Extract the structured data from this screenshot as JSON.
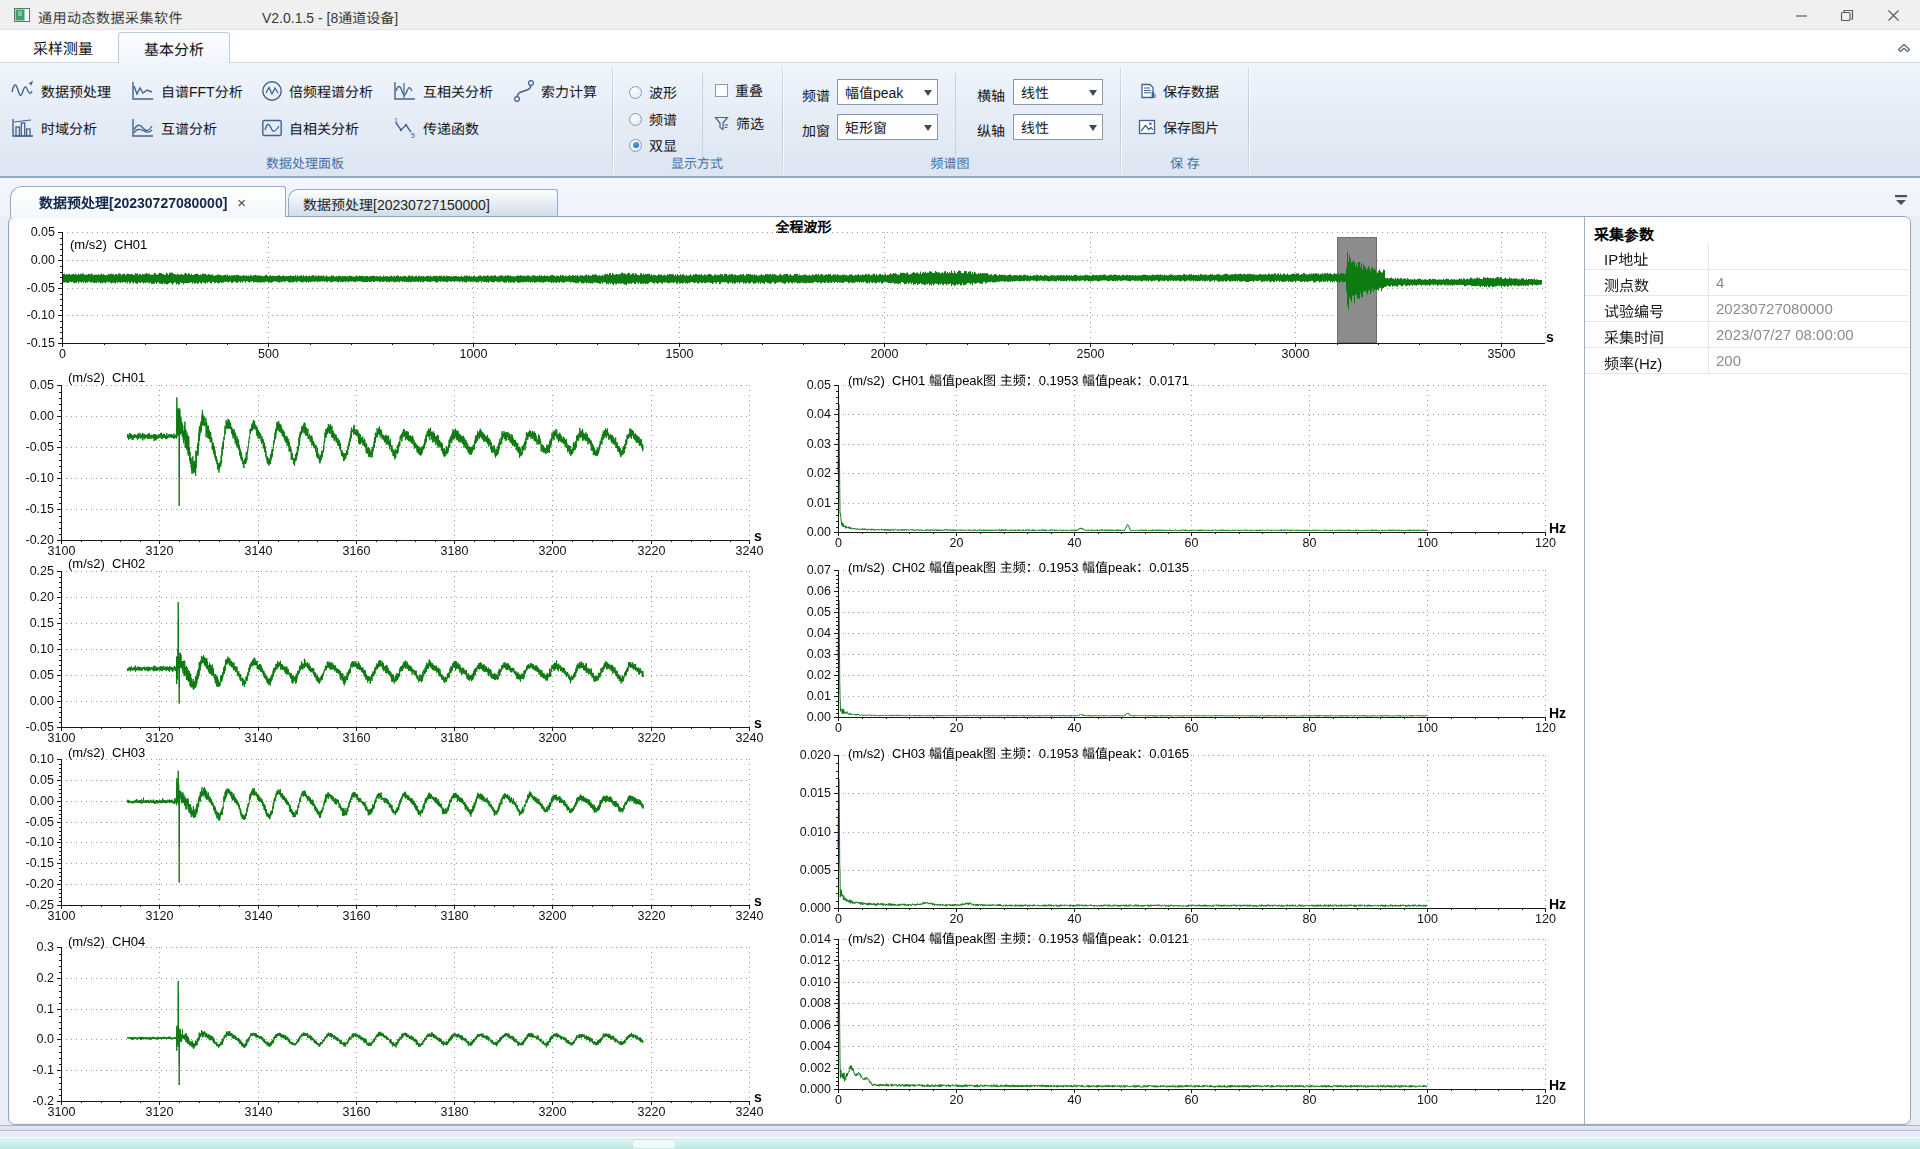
{
  "window": {
    "title": "通用动态数据采集软件",
    "version": "V2.0.1.5 - [8通道设备]"
  },
  "ribbon_tabs": {
    "sampling": "采样测量",
    "analysis": "基本分析"
  },
  "ribbon": {
    "group1": {
      "label": "数据处理面板",
      "btn_preprocess": "数据预处理",
      "btn_fft": "自谱FFT分析",
      "btn_octave": "倍频程谱分析",
      "btn_xcorr": "互相关分析",
      "btn_cable": "索力计算",
      "btn_timedomain": "时域分析",
      "btn_xspec": "互谱分析",
      "btn_autocorr": "自相关分析",
      "btn_transfer": "传递函数"
    },
    "group2": {
      "label": "显示方式",
      "radio_wave": "波形",
      "radio_spec": "频谱",
      "radio_dual": "双显",
      "selected_radio": "双显",
      "chk_overlap": "重叠",
      "chk_overlap_checked": false,
      "btn_filter": "筛选"
    },
    "group3": {
      "label": "频谱图",
      "lbl_spectrum": "频谱",
      "val_spectrum": "幅值peak",
      "lbl_window": "加窗",
      "val_window": "矩形窗",
      "lbl_xaxis": "横轴",
      "val_xaxis": "线性",
      "lbl_yaxis": "纵轴",
      "val_yaxis": "线性"
    },
    "group4": {
      "label": "保 存",
      "btn_savedata": "保存数据",
      "btn_saveimage": "保存图片"
    }
  },
  "doc_tabs": {
    "tab1": "数据预处理[20230727080000]",
    "tab1_close": "×",
    "tab2": "数据预处理[20230727150000]"
  },
  "params_panel": {
    "title": "采集参数",
    "rows": [
      {
        "label": "IP地址",
        "value": ""
      },
      {
        "label": "测点数",
        "value": "4"
      },
      {
        "label": "试验编号",
        "value": "20230727080000"
      },
      {
        "label": "采集时间",
        "value": "2023/07/27 08:00:00"
      },
      {
        "label": "频率(Hz)",
        "value": "200"
      }
    ]
  },
  "chart_data": [
    {
      "id": "overview",
      "type": "line",
      "title": "全程波形",
      "series_label": "(m/s2)  CH01",
      "unit": "s",
      "line_color": "#0e7a12",
      "x_range": [
        0,
        3608
      ],
      "y_range": [
        0.05,
        -0.15
      ],
      "x_ticks": [
        {
          "v": 0,
          "l": "0"
        },
        {
          "v": 500,
          "l": "500"
        },
        {
          "v": 1000,
          "l": "1000"
        },
        {
          "v": 1500,
          "l": "1500"
        },
        {
          "v": 2000,
          "l": "2000"
        },
        {
          "v": 2500,
          "l": "2500"
        },
        {
          "v": 3000,
          "l": "3000"
        },
        {
          "v": 3500,
          "l": "3500"
        }
      ],
      "y_ticks": [
        {
          "v": 0.05,
          "l": "0.05"
        },
        {
          "v": 0.0,
          "l": "0.00"
        },
        {
          "v": -0.05,
          "l": "-0.05"
        },
        {
          "v": -0.1,
          "l": "-0.10"
        },
        {
          "v": -0.15,
          "l": "-0.15"
        }
      ],
      "selection": {
        "t0": 3102,
        "t1": 3200,
        "fill": "#8c8c8c",
        "border": "#6f6f6f"
      },
      "gen": {
        "kind": "overview",
        "seed": 11,
        "t_end": 3600,
        "base": -0.0335,
        "half": 0.0062,
        "event_t": 3123.5,
        "event_end": 3218.5,
        "osc_amp": 0.034,
        "osc_tau": 42,
        "post_base": -0.0405,
        "bumps": [
          [
            270,
            60,
            0.002
          ],
          [
            1360,
            40,
            0.0025
          ],
          [
            2120,
            70,
            0.0045
          ],
          [
            2200,
            40,
            0.003
          ],
          [
            3480,
            50,
            0.003
          ]
        ]
      }
    },
    {
      "id": "time_ch01",
      "type": "line",
      "title": "(m/s2)  CH01",
      "unit": "s",
      "line_color": "#0e7a12",
      "x_range": [
        3100,
        3240
      ],
      "y_range": [
        0.05,
        -0.2
      ],
      "x_ticks": [
        {
          "v": 3100,
          "l": "3100"
        },
        {
          "v": 3120,
          "l": "3120"
        },
        {
          "v": 3140,
          "l": "3140"
        },
        {
          "v": 3160,
          "l": "3160"
        },
        {
          "v": 3180,
          "l": "3180"
        },
        {
          "v": 3200,
          "l": "3200"
        },
        {
          "v": 3220,
          "l": "3220"
        },
        {
          "v": 3240,
          "l": "3240"
        }
      ],
      "y_ticks": [
        {
          "v": 0.05,
          "l": "0.05"
        },
        {
          "v": 0,
          "l": "0.00"
        },
        {
          "v": -0.05,
          "l": "-0.05"
        },
        {
          "v": -0.1,
          "l": "-0.10"
        },
        {
          "v": -0.15,
          "l": "-0.15"
        },
        {
          "v": -0.2,
          "l": "-0.20"
        }
      ],
      "gen": {
        "kind": "timezoom",
        "seed": 21,
        "base": -0.033,
        "sigma0": 0.0032,
        "spike_up": 0.012,
        "spike_dn": -0.145,
        "osc_mean": -0.042,
        "A0": 0.023,
        "A1": 0.0105,
        "tau": 50,
        "sigma1": 0.0058,
        "f0": 0.1953,
        "h2": 0.3
      }
    },
    {
      "id": "time_ch02",
      "type": "line",
      "title": "(m/s2)  CH02",
      "unit": "s",
      "line_color": "#0e7a12",
      "x_range": [
        3100,
        3240
      ],
      "y_range": [
        0.25,
        -0.05
      ],
      "x_ticks": [
        {
          "v": 3100,
          "l": "3100"
        },
        {
          "v": 3120,
          "l": "3120"
        },
        {
          "v": 3140,
          "l": "3140"
        },
        {
          "v": 3160,
          "l": "3160"
        },
        {
          "v": 3180,
          "l": "3180"
        },
        {
          "v": 3200,
          "l": "3200"
        },
        {
          "v": 3220,
          "l": "3220"
        },
        {
          "v": 3240,
          "l": "3240"
        }
      ],
      "y_ticks": [
        {
          "v": 0.25,
          "l": "0.25"
        },
        {
          "v": 0.2,
          "l": "0.20"
        },
        {
          "v": 0.15,
          "l": "0.15"
        },
        {
          "v": 0.1,
          "l": "0.10"
        },
        {
          "v": 0.05,
          "l": "0.05"
        },
        {
          "v": 0,
          "l": "0.00"
        },
        {
          "v": -0.05,
          "l": "-0.05"
        }
      ],
      "gen": {
        "kind": "timezoom",
        "seed": 22,
        "base": 0.062,
        "sigma0": 0.003,
        "spike_up": 0.19,
        "spike_dn": -0.005,
        "osc_mean": 0.057,
        "A0": 0.014,
        "A1": 0.009,
        "tau": 60,
        "sigma1": 0.0052,
        "f0": 0.1953,
        "h2": 0.25
      }
    },
    {
      "id": "time_ch03",
      "type": "line",
      "title": "(m/s2)  CH03",
      "unit": "s",
      "line_color": "#0e7a12",
      "x_range": [
        3100,
        3240
      ],
      "y_range": [
        0.1,
        -0.25
      ],
      "x_ticks": [
        {
          "v": 3100,
          "l": "3100"
        },
        {
          "v": 3120,
          "l": "3120"
        },
        {
          "v": 3140,
          "l": "3140"
        },
        {
          "v": 3160,
          "l": "3160"
        },
        {
          "v": 3180,
          "l": "3180"
        },
        {
          "v": 3200,
          "l": "3200"
        },
        {
          "v": 3220,
          "l": "3220"
        },
        {
          "v": 3240,
          "l": "3240"
        }
      ],
      "y_ticks": [
        {
          "v": 0.1,
          "l": "0.10"
        },
        {
          "v": 0.05,
          "l": "0.05"
        },
        {
          "v": 0,
          "l": "0.00"
        },
        {
          "v": -0.05,
          "l": "-0.05"
        },
        {
          "v": -0.1,
          "l": "-0.10"
        },
        {
          "v": -0.15,
          "l": "-0.15"
        },
        {
          "v": -0.2,
          "l": "-0.20"
        },
        {
          "v": -0.25,
          "l": "-0.25"
        }
      ],
      "gen": {
        "kind": "timezoom",
        "seed": 23,
        "base": -0.002,
        "sigma0": 0.003,
        "spike_up": 0.072,
        "spike_dn": -0.196,
        "osc_mean": -0.006,
        "A0": 0.02,
        "A1": 0.0095,
        "tau": 55,
        "sigma1": 0.0054,
        "f0": 0.1953,
        "h2": 0.28
      }
    },
    {
      "id": "time_ch04",
      "type": "line",
      "title": "(m/s2)  CH04",
      "unit": "s",
      "line_color": "#0e7a12",
      "x_range": [
        3100,
        3240
      ],
      "y_range": [
        0.3,
        -0.2
      ],
      "x_ticks": [
        {
          "v": 3100,
          "l": "3100"
        },
        {
          "v": 3120,
          "l": "3120"
        },
        {
          "v": 3140,
          "l": "3140"
        },
        {
          "v": 3160,
          "l": "3160"
        },
        {
          "v": 3180,
          "l": "3180"
        },
        {
          "v": 3200,
          "l": "3200"
        },
        {
          "v": 3220,
          "l": "3220"
        },
        {
          "v": 3240,
          "l": "3240"
        }
      ],
      "y_ticks": [
        {
          "v": 0.3,
          "l": "0.3"
        },
        {
          "v": 0.2,
          "l": "0.2"
        },
        {
          "v": 0.1,
          "l": "0.1"
        },
        {
          "v": 0,
          "l": "0.0"
        },
        {
          "v": -0.1,
          "l": "-0.1"
        },
        {
          "v": -0.2,
          "l": "-0.2"
        }
      ],
      "gen": {
        "kind": "timezoom",
        "seed": 24,
        "base": 0.004,
        "sigma0": 0.003,
        "spike_up": 0.19,
        "spike_dn": -0.148,
        "osc_mean": 0.001,
        "A0": 0.01,
        "A1": 0.0085,
        "tau": 70,
        "sigma1": 0.0048,
        "f0": 0.1953,
        "h2": 0.22
      }
    },
    {
      "id": "spec_ch01",
      "type": "line",
      "title": "(m/s2)  CH01 幅值peak图 主频：0.1953 幅值peak：0.0171",
      "main_freq": 0.1953,
      "peak": 0.0171,
      "unit": "Hz",
      "line_color": "#0e7a12",
      "x_range": [
        0,
        120.06
      ],
      "y_range": [
        0.05,
        0
      ],
      "x_ticks": [
        {
          "v": 0,
          "l": "0"
        },
        {
          "v": 20,
          "l": "20"
        },
        {
          "v": 40,
          "l": "40"
        },
        {
          "v": 60,
          "l": "60"
        },
        {
          "v": 80,
          "l": "80"
        },
        {
          "v": 100,
          "l": "100"
        },
        {
          "v": 120,
          "l": "120"
        }
      ],
      "y_ticks": [
        {
          "v": 0.05,
          "l": "0.05"
        },
        {
          "v": 0.04,
          "l": "0.04"
        },
        {
          "v": 0.03,
          "l": "0.03"
        },
        {
          "v": 0.02,
          "l": "0.02"
        },
        {
          "v": 0.01,
          "l": "0.01"
        },
        {
          "v": 0,
          "l": "0.00"
        }
      ],
      "gen": {
        "kind": "spectrum",
        "seed": 31,
        "dc": 0.0371,
        "tail": 0.0042,
        "fc": 0.75,
        "pw": 1.5,
        "floor": 0.00045,
        "bumps": [
          [
            41.3,
            0.0006,
            0.35
          ],
          [
            49.2,
            0.0019,
            0.22
          ]
        ],
        "rip": 0.0002,
        "ripf": 100
      }
    },
    {
      "id": "spec_ch02",
      "type": "line",
      "title": "(m/s2)  CH02 幅值peak图 主频：0.1953 幅值peak：0.0135",
      "main_freq": 0.1953,
      "peak": 0.0135,
      "unit": "Hz",
      "line_color": "#0e7a12",
      "x_range": [
        0,
        120.06
      ],
      "y_range": [
        0.07,
        0
      ],
      "x_ticks": [
        {
          "v": 0,
          "l": "0"
        },
        {
          "v": 20,
          "l": "20"
        },
        {
          "v": 40,
          "l": "40"
        },
        {
          "v": 60,
          "l": "60"
        },
        {
          "v": 80,
          "l": "80"
        },
        {
          "v": 100,
          "l": "100"
        },
        {
          "v": 120,
          "l": "120"
        }
      ],
      "y_ticks": [
        {
          "v": 0.07,
          "l": "0.07"
        },
        {
          "v": 0.06,
          "l": "0.06"
        },
        {
          "v": 0.05,
          "l": "0.05"
        },
        {
          "v": 0.04,
          "l": "0.04"
        },
        {
          "v": 0.03,
          "l": "0.03"
        },
        {
          "v": 0.02,
          "l": "0.02"
        },
        {
          "v": 0.01,
          "l": "0.01"
        },
        {
          "v": 0,
          "l": "0.00"
        }
      ],
      "gen": {
        "kind": "spectrum",
        "seed": 32,
        "dc": 0.0512,
        "tail": 0.005,
        "fc": 0.7,
        "pw": 1.5,
        "floor": 0.00045,
        "bumps": [
          [
            41.3,
            0.0005,
            0.35
          ],
          [
            49.2,
            0.0013,
            0.22
          ]
        ],
        "rip": 0.0002,
        "ripf": 100
      }
    },
    {
      "id": "spec_ch03",
      "type": "line",
      "title": "(m/s2)  CH03 幅值peak图 主频：0.1953 幅值peak：0.0165",
      "main_freq": 0.1953,
      "peak": 0.0165,
      "unit": "Hz",
      "line_color": "#0e7a12",
      "x_range": [
        0,
        120.06
      ],
      "y_range": [
        0.02,
        0
      ],
      "x_ticks": [
        {
          "v": 0,
          "l": "0"
        },
        {
          "v": 20,
          "l": "20"
        },
        {
          "v": 40,
          "l": "40"
        },
        {
          "v": 60,
          "l": "60"
        },
        {
          "v": 80,
          "l": "80"
        },
        {
          "v": 100,
          "l": "100"
        },
        {
          "v": 120,
          "l": "120"
        }
      ],
      "y_ticks": [
        {
          "v": 0.02,
          "l": "0.020"
        },
        {
          "v": 0.015,
          "l": "0.015"
        },
        {
          "v": 0.01,
          "l": "0.010"
        },
        {
          "v": 0.005,
          "l": "0.005"
        },
        {
          "v": 0,
          "l": "0.000"
        }
      ],
      "gen": {
        "kind": "spectrum",
        "seed": 33,
        "dc": 0.0145,
        "tail": 0.0021,
        "fc": 0.8,
        "pw": 1.45,
        "floor": 0.00027,
        "bumps": [
          [
            15,
            0.00028,
            0.8
          ],
          [
            22,
            0.0002,
            0.8
          ]
        ],
        "rip": 0.00022,
        "ripf": 28
      }
    },
    {
      "id": "spec_ch04",
      "type": "line",
      "title": "(m/s2)  CH04 幅值peak图 主频：0.1953 幅值peak：0.0121",
      "main_freq": 0.1953,
      "peak": 0.0121,
      "unit": "Hz",
      "line_color": "#0e7a12",
      "x_range": [
        0,
        120.06
      ],
      "y_range": [
        0.014,
        0
      ],
      "x_ticks": [
        {
          "v": 0,
          "l": "0"
        },
        {
          "v": 20,
          "l": "20"
        },
        {
          "v": 40,
          "l": "40"
        },
        {
          "v": 60,
          "l": "60"
        },
        {
          "v": 80,
          "l": "80"
        },
        {
          "v": 100,
          "l": "100"
        },
        {
          "v": 120,
          "l": "120"
        }
      ],
      "y_ticks": [
        {
          "v": 0.014,
          "l": "0.014"
        },
        {
          "v": 0.012,
          "l": "0.012"
        },
        {
          "v": 0.01,
          "l": "0.010"
        },
        {
          "v": 0.008,
          "l": "0.008"
        },
        {
          "v": 0.006,
          "l": "0.006"
        },
        {
          "v": 0.004,
          "l": "0.004"
        },
        {
          "v": 0.002,
          "l": "0.002"
        },
        {
          "v": 0,
          "l": "0.000"
        }
      ],
      "gen": {
        "kind": "spectrum",
        "seed": 34,
        "dc": 0.0107,
        "tail": 0.0014,
        "fc": 0.9,
        "pw": 1.5,
        "floor": 0.00022,
        "bumps": [
          [
            2.2,
            0.0014,
            0.5
          ],
          [
            3.6,
            0.0009,
            0.45
          ],
          [
            4.9,
            0.0006,
            0.4
          ]
        ],
        "rip": 0.00015,
        "ripf": 37
      }
    }
  ]
}
